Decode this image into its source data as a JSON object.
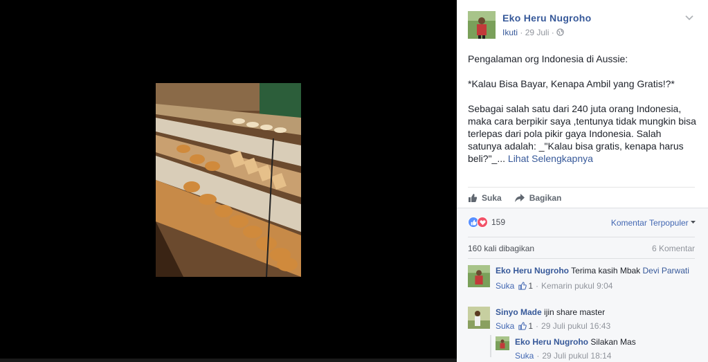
{
  "post": {
    "author": "Eko Heru Nugroho",
    "follow_label": "Ikuti",
    "date": "29 Juli",
    "paragraphs": [
      "Pengalaman org Indonesia di Aussie:",
      "*Kalau Bisa Bayar, Kenapa Ambil yang Gratis!?*",
      "Sebagai salah satu dari 240 juta orang Indonesia, maka cara berpikir saya ,tentunya tidak mungkin bisa terlepas dari pola pikir gaya Indonesia. Salah satunya adalah: _\"Kalau bisa gratis, kenapa harus beli?\"_..."
    ],
    "see_more": "Lihat Selengkapnya"
  },
  "actions": {
    "like": "Suka",
    "share": "Bagikan"
  },
  "feedback": {
    "reaction_count": "159",
    "sort_label": "Komentar Terpopuler",
    "shares": "160 kali dibagikan",
    "comment_count": "6 Komentar"
  },
  "comments": [
    {
      "name": "Eko Heru Nugroho",
      "text": "Terima kasih Mbak",
      "mention": "Devi Parwati",
      "like_label": "Suka",
      "likes": "1",
      "time": "Kemarin pukul 9:04"
    },
    {
      "name": "Sinyo Made",
      "text": "ijin share master",
      "like_label": "Suka",
      "likes": "1",
      "time": "29 Juli pukul 16:43"
    },
    {
      "name": "Eko Heru Nugroho",
      "text": "Silakan Mas",
      "like_label": "Suka",
      "time": "29 Juli pukul 18:14"
    }
  ],
  "colors": {
    "link": "#365899",
    "like_blue": "#5890ff",
    "love_red": "#f25268"
  },
  "icons": [
    "chevron-down-icon",
    "globe-icon",
    "thumbs-up-icon",
    "share-arrow-icon",
    "like-reaction-icon",
    "love-reaction-icon",
    "caret-down-icon"
  ]
}
